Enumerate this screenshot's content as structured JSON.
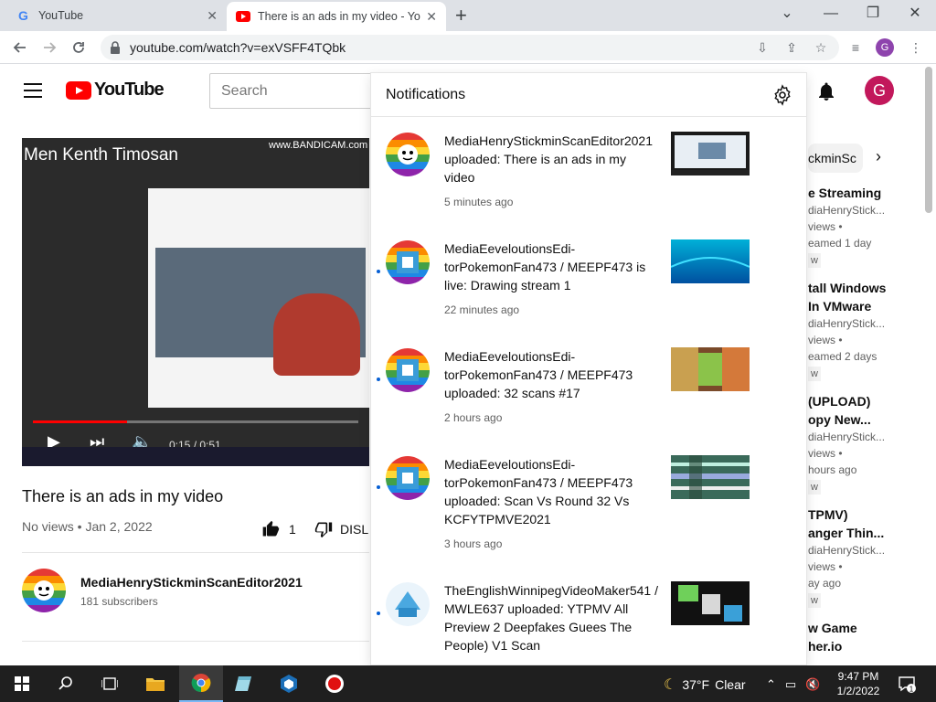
{
  "browser": {
    "tabs": [
      {
        "title": "YouTube",
        "active": false
      },
      {
        "title": "There is an ads in my video - You",
        "active": true
      }
    ],
    "url": "youtube.com/watch?v=exVSFF4TQbk",
    "profile_initial": "G"
  },
  "youtube": {
    "logo_text": "YouTube",
    "search_placeholder": "Search",
    "avatar_initial": "G",
    "player": {
      "overlay_title": "Men Kenth Timosan",
      "watermark": "www.BANDICAM.com",
      "time": "0:15 / 0:51",
      "progress": 0.29
    },
    "video": {
      "title": "There is an ads in my video",
      "meta": "No views • Jan 2, 2022",
      "likes": "1",
      "dislike_label": "DISL"
    },
    "channel": {
      "name": "MediaHenryStickminScanEditor2021",
      "subscribers": "181 subscribers"
    },
    "sidebar": {
      "chip": "ckminSc",
      "items": [
        {
          "title": "e Streaming",
          "lines": [
            "diaHenryStick...",
            "views •",
            "eamed 1 day"
          ],
          "badge": "w"
        },
        {
          "title": "tall Windows",
          "title2": "In VMware",
          "lines": [
            "diaHenryStick...",
            "views •",
            "eamed 2 days"
          ],
          "badge": "w"
        },
        {
          "title": "(UPLOAD)",
          "title2": "opy New...",
          "lines": [
            "diaHenryStick...",
            "views •",
            "hours ago"
          ],
          "badge": "w"
        },
        {
          "title": "TPMV)",
          "title2": "anger Thin...",
          "lines": [
            "diaHenryStick...",
            "views •",
            "ay ago"
          ],
          "badge": "w"
        },
        {
          "title": "w Game",
          "title2": "her.io",
          "lines": [],
          "badge": ""
        }
      ]
    }
  },
  "notifications": {
    "title": "Notifications",
    "items": [
      {
        "text": "MediaHenryStickminScanEditor2021 uploaded: There is an ads in my video",
        "age": "5 minutes ago",
        "unread": false
      },
      {
        "text": "MediaEeveloutionsEdi-torPokemonFan473 / MEEPF473 is live: Drawing stream 1",
        "age": "22 minutes ago",
        "unread": true
      },
      {
        "text": "MediaEeveloutionsEdi-torPokemonFan473 / MEEPF473 uploaded: 32 scans #17",
        "age": "2 hours ago",
        "unread": true
      },
      {
        "text": "MediaEeveloutionsEdi-torPokemonFan473 / MEEPF473 uploaded: Scan Vs Round 32 Vs KCFYTPMVE2021",
        "age": "3 hours ago",
        "unread": true
      },
      {
        "text": "TheEnglishWinnipegVideoMaker541 / MWLE637 uploaded: YTPMV All Preview 2 Deepfakes Guees The People) V1 Scan",
        "age": "",
        "unread": true
      }
    ]
  },
  "taskbar": {
    "weather_temp": "37°F",
    "weather_desc": "Clear",
    "time": "9:47 PM",
    "date": "1/2/2022",
    "notification_count": "1"
  },
  "colors": {
    "youtube_red": "#ff0000",
    "avatar_pink": "#c2185b",
    "unread_blue": "#065fd4"
  }
}
